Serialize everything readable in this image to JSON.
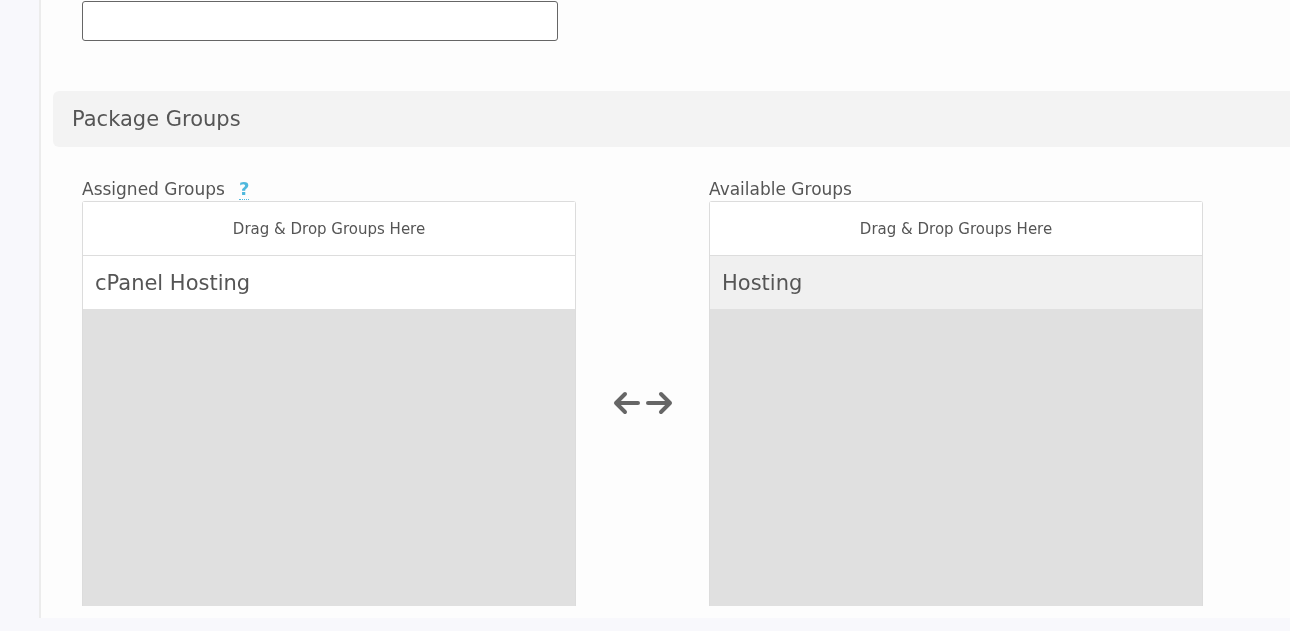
{
  "section": {
    "title": "Package Groups"
  },
  "lists": [
    {
      "label": "Assigned Groups",
      "help": "?",
      "drop_hint": "Drag & Drop Groups Here",
      "items": [
        {
          "name": "cPanel Hosting",
          "selected": false
        }
      ]
    },
    {
      "label": "Available Groups",
      "drop_hint": "Drag & Drop Groups Here",
      "items": [
        {
          "name": "Hosting",
          "selected": true
        }
      ]
    }
  ]
}
